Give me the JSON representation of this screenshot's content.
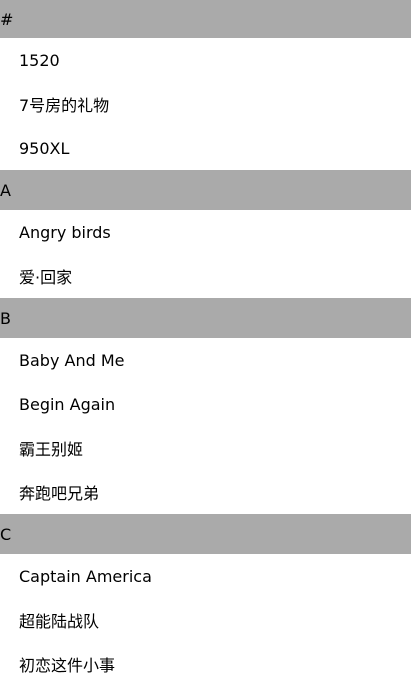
{
  "sections": [
    {
      "header": "#",
      "items": [
        "1520",
        "7号房的礼物",
        "950XL"
      ]
    },
    {
      "header": "A",
      "items": [
        "Angry birds",
        "爱·回家"
      ]
    },
    {
      "header": "B",
      "items": [
        "Baby And Me",
        "Begin Again",
        "霸王别姬",
        "奔跑吧兄弟"
      ]
    },
    {
      "header": "C",
      "items": [
        "Captain America",
        "超能陆战队",
        "初恋这件小事"
      ]
    }
  ],
  "colors": {
    "section_header_bg": "#aaaaaa",
    "row_bg": "#ffffff",
    "text": "#000000"
  }
}
